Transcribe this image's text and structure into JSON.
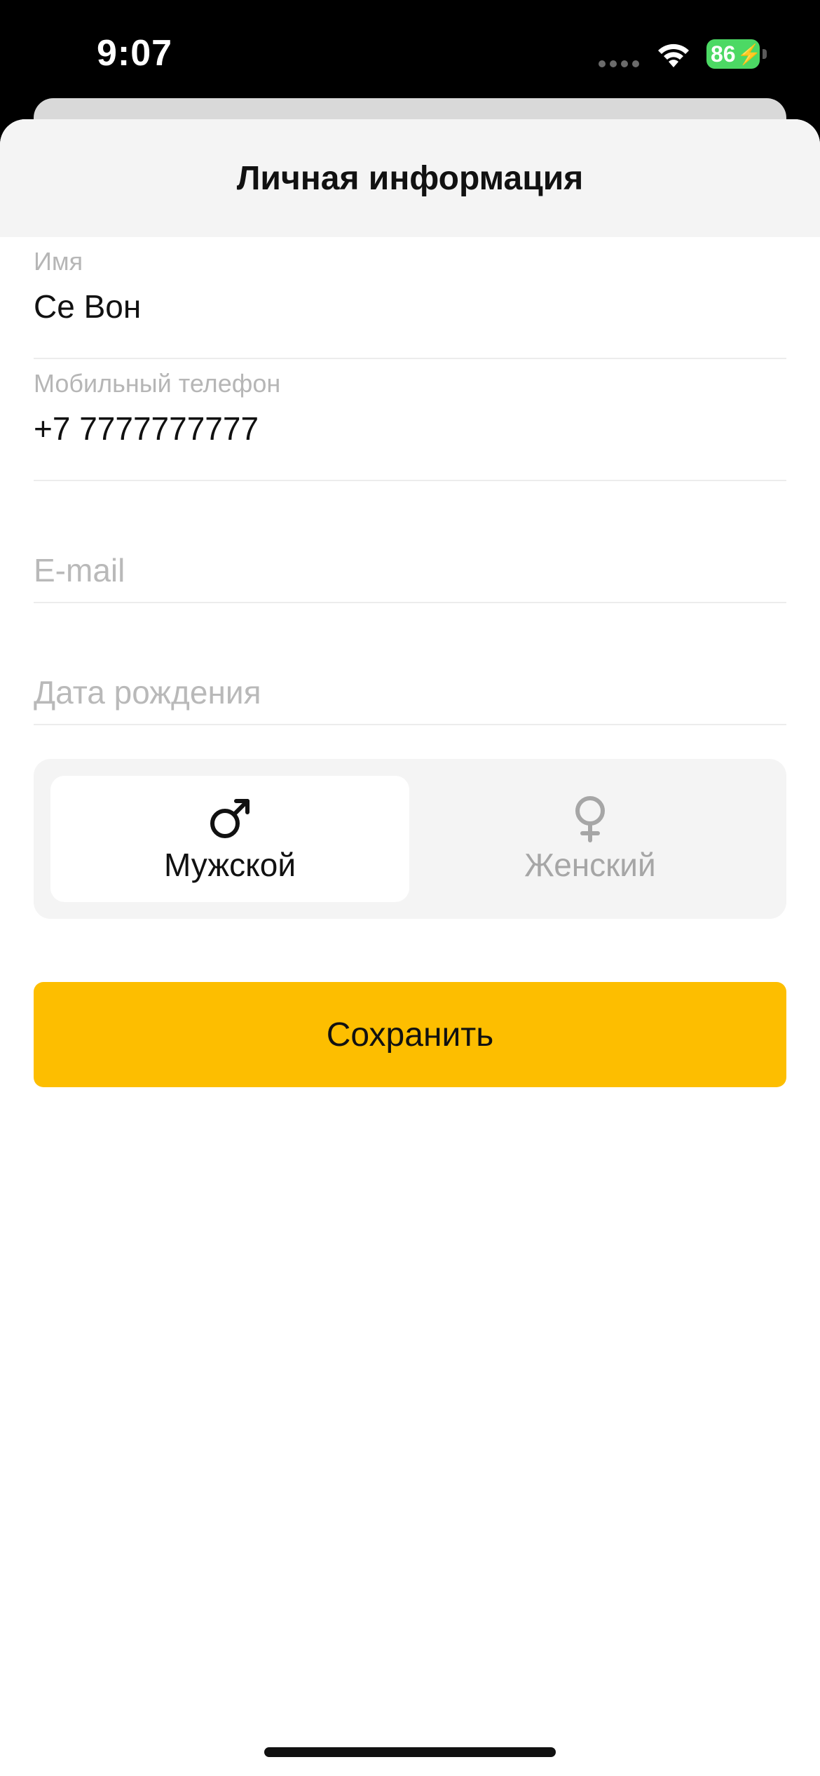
{
  "status_bar": {
    "time": "9:07",
    "battery_percent": "86"
  },
  "header": {
    "title": "Личная информация"
  },
  "form": {
    "name": {
      "label": "Имя",
      "value": "Се Вон"
    },
    "phone": {
      "label": "Мобильный телефон",
      "value": "+7 7777777777"
    },
    "email": {
      "placeholder": "E-mail"
    },
    "birthdate": {
      "placeholder": "Дата рождения"
    }
  },
  "gender": {
    "selected": "male",
    "options": [
      {
        "id": "male",
        "label": "Мужской",
        "icon": "male-symbol-icon"
      },
      {
        "id": "female",
        "label": "Женский",
        "icon": "female-symbol-icon"
      }
    ]
  },
  "actions": {
    "save_label": "Сохранить"
  },
  "colors": {
    "accent": "#FDBE00",
    "battery": "#4CD964",
    "header_bg": "#F4F4F4"
  }
}
